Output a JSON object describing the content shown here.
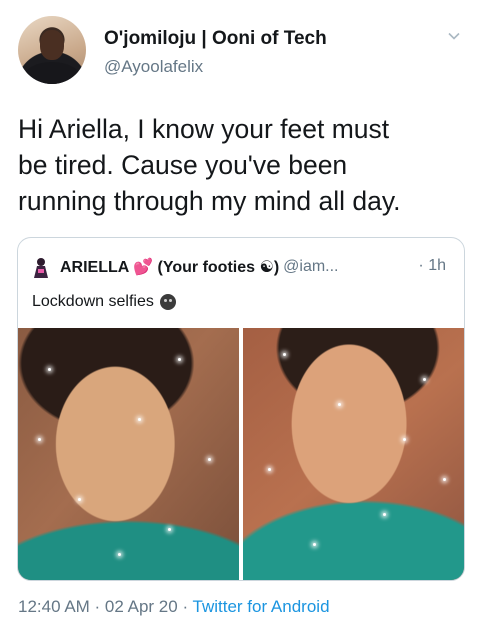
{
  "author": {
    "display_name": "O'jomiloju | Ooni of Tech",
    "handle": "@Ayoolafelix"
  },
  "tweet_text": "Hi Ariella, I know your feet must\nbe tired. Cause you've been\nrunning through my mind all day.",
  "quoted_tweet": {
    "display_name": "ARIELLA 💕 (Your footies ☯)",
    "handle": "@iam...",
    "time_ago": "· 1h",
    "text": "Lockdown selfies",
    "photos": [
      "selfie-photo-1",
      "selfie-photo-2"
    ]
  },
  "footer": {
    "timestamp": "12:40 AM · 02 Apr 20 · ",
    "source": "Twitter for Android"
  },
  "colors": {
    "text": "#14171a",
    "secondary": "#657786",
    "link": "#1b95e0",
    "border": "#ccd6dd"
  },
  "icons": {
    "caret": "chevron-down-icon",
    "quote_avatar": "profile-avatar-icon",
    "emoji": "face-emoji-icon"
  }
}
